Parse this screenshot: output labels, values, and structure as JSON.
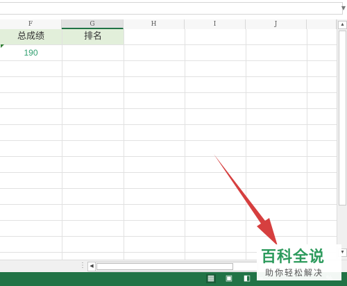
{
  "columns": [
    {
      "letter": "F"
    },
    {
      "letter": "G"
    },
    {
      "letter": "H"
    },
    {
      "letter": "I"
    },
    {
      "letter": "J"
    }
  ],
  "cells": {
    "F1": "总成绩",
    "G1": "排名",
    "F2": "190"
  },
  "selected_column": "G",
  "status_bar": {
    "zoom_minus": "−",
    "zoom_label": "%"
  },
  "watermark": {
    "title": "百科全说",
    "subtitle": "助你轻松解决"
  },
  "colors": {
    "header_fill": "#e2efda",
    "value_text": "#2e9e6e",
    "status_bar": "#217346",
    "arrow": "#d32f2f"
  },
  "icons": [
    "normal-view-icon",
    "page-layout-view-icon",
    "page-break-view-icon",
    "dropdown-arrow-icon"
  ]
}
